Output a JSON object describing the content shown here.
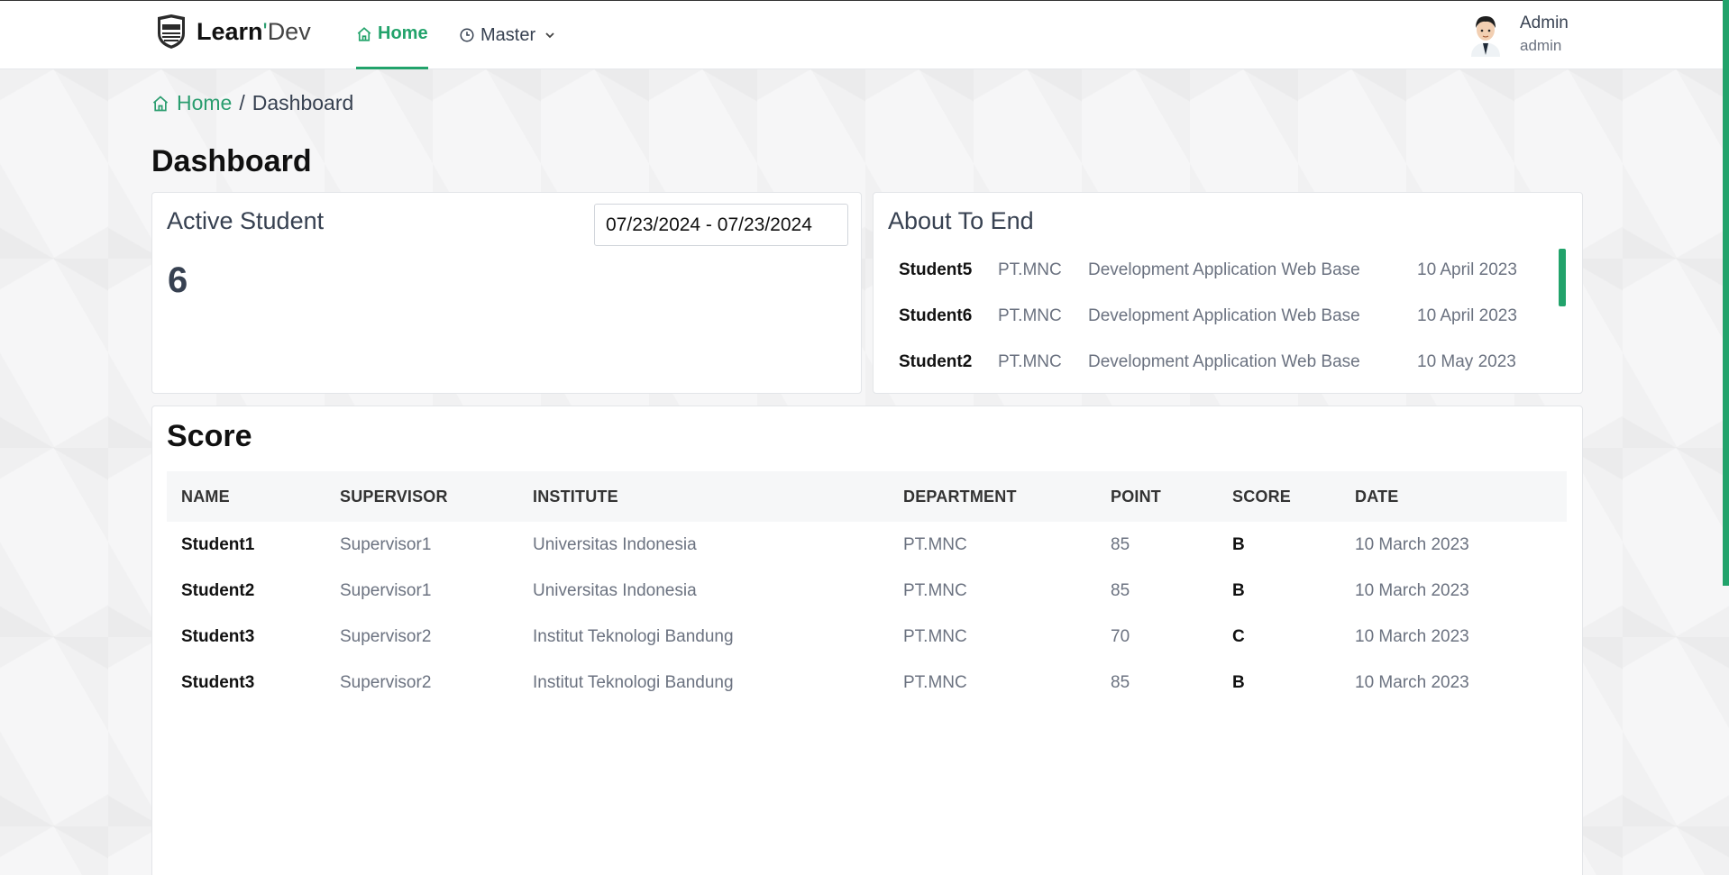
{
  "header": {
    "brand_bold": "Learn",
    "brand_apos": "'",
    "brand_light": "Dev",
    "nav_home": "Home",
    "nav_master": "Master",
    "user_name": "Admin",
    "user_role": "admin"
  },
  "breadcrumb": {
    "home": "Home",
    "separator": "/",
    "current": "Dashboard"
  },
  "page_title": "Dashboard",
  "active_student": {
    "title": "Active Student",
    "count": "6",
    "date_range": "07/23/2024 - 07/23/2024"
  },
  "about_to_end": {
    "title": "About To End",
    "rows": [
      {
        "name": "Student5",
        "department": "PT.MNC",
        "program": "Development Application Web Base",
        "date": "10 April 2023"
      },
      {
        "name": "Student6",
        "department": "PT.MNC",
        "program": "Development Application Web Base",
        "date": "10 April 2023"
      },
      {
        "name": "Student2",
        "department": "PT.MNC",
        "program": "Development Application Web Base",
        "date": "10 May 2023"
      }
    ]
  },
  "score": {
    "title": "Score",
    "columns": [
      "NAME",
      "SUPERVISOR",
      "INSTITUTE",
      "DEPARTMENT",
      "POINT",
      "SCORE",
      "DATE"
    ],
    "rows": [
      {
        "name": "Student1",
        "supervisor": "Supervisor1",
        "institute": "Universitas Indonesia",
        "department": "PT.MNC",
        "point": "85",
        "score": "B",
        "date": "10 March 2023"
      },
      {
        "name": "Student2",
        "supervisor": "Supervisor1",
        "institute": "Universitas Indonesia",
        "department": "PT.MNC",
        "point": "85",
        "score": "B",
        "date": "10 March 2023"
      },
      {
        "name": "Student3",
        "supervisor": "Supervisor2",
        "institute": "Institut Teknologi Bandung",
        "department": "PT.MNC",
        "point": "70",
        "score": "C",
        "date": "10 March 2023"
      },
      {
        "name": "Student3",
        "supervisor": "Supervisor2",
        "institute": "Institut Teknologi Bandung",
        "department": "PT.MNC",
        "point": "85",
        "score": "B",
        "date": "10 March 2023"
      }
    ]
  },
  "colors": {
    "accent": "#22a36b",
    "text": "#374151",
    "muted": "#6b7280"
  },
  "icons": {
    "home": "home-icon",
    "master": "clock-icon",
    "chevron": "chevron-down-icon"
  }
}
